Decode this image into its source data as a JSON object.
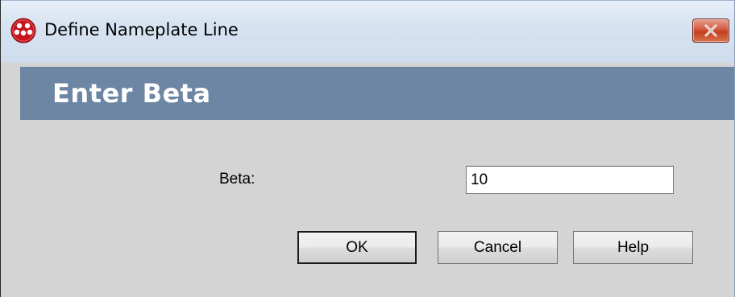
{
  "window": {
    "title": "Define Nameplate Line",
    "close_label": "×"
  },
  "header": {
    "title": "Enter Beta"
  },
  "form": {
    "beta_label": "Beta:",
    "beta_value": "10"
  },
  "buttons": {
    "ok_label": "OK",
    "cancel_label": "Cancel",
    "help_label": "Help"
  },
  "colors": {
    "header_band": "#6d86a3",
    "dialog_body": "#d4d4d4",
    "close_button": "#c2401f",
    "app_icon": "#c8141c"
  },
  "icons": {
    "app": "app-logo-icon",
    "close": "close-icon"
  }
}
